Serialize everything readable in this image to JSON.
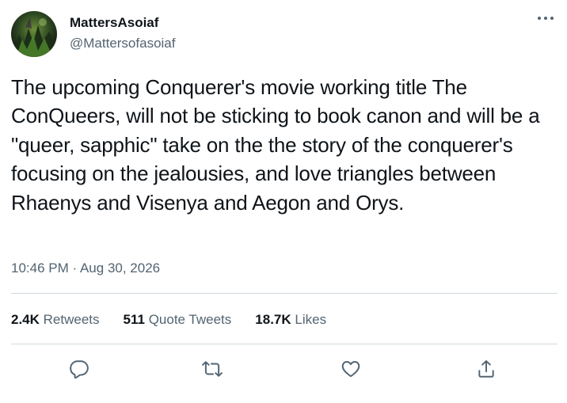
{
  "author": {
    "display_name": "MattersAsoiaf",
    "handle": "@Mattersofasoiaf",
    "avatar_icon": "avatar-image"
  },
  "tweet": {
    "text": "The upcoming Conquerer's movie working title The ConQueers, will not be sticking to book canon and will be a \"queer, sapphic\" take on the the story of the conquerer's focusing on the jealousies, and love triangles between Rhaenys and Visenya and Aegon and Orys.",
    "time": "10:46 PM",
    "separator": "·",
    "date": "Aug 30, 2026"
  },
  "stats": {
    "retweets_count": "2.4K",
    "retweets_label": "Retweets",
    "quotes_count": "511",
    "quotes_label": "Quote Tweets",
    "likes_count": "18.7K",
    "likes_label": "Likes"
  },
  "actions": {
    "reply_icon": "reply-icon",
    "retweet_icon": "retweet-icon",
    "like_icon": "heart-icon",
    "share_icon": "share-icon"
  },
  "colors": {
    "text_primary": "#0f1419",
    "text_secondary": "#536471",
    "divider": "#cfd9de",
    "background": "#ffffff"
  }
}
